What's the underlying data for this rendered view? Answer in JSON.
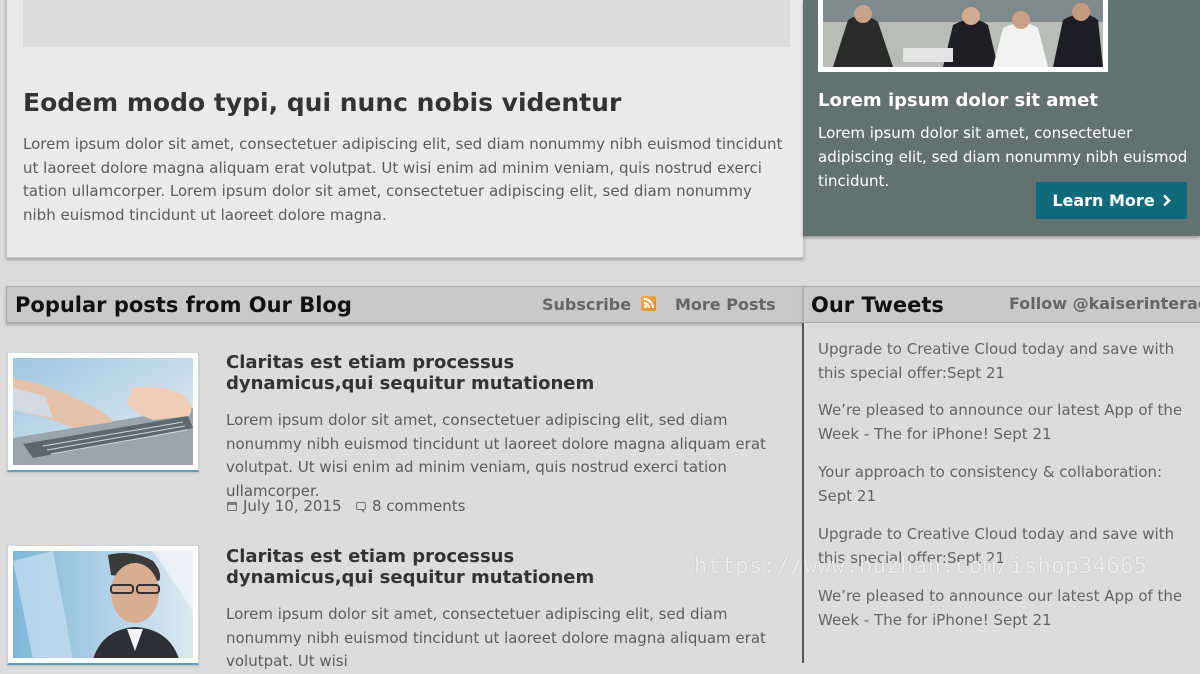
{
  "feature": {
    "title": "Eodem modo typi, qui nunc nobis videntur",
    "body": "Lorem ipsum dolor sit amet, consectetuer adipiscing elit, sed diam nonummy nibh euismod tincidunt ut laoreet dolore magna aliquam erat volutpat. Ut wisi enim ad minim veniam, quis nostrud exerci tation ullamcorper. Lorem ipsum dolor sit amet, consectetuer adipiscing elit, sed diam nonummy nibh euismod tincidunt ut laoreet dolore magna."
  },
  "promo": {
    "title": "Lorem ipsum dolor sit amet",
    "body": "Lorem ipsum dolor sit amet, consectetuer adipiscing elit, sed diam nonummy nibh euismod tincidunt.",
    "button_label": "Learn More",
    "button_icon": "chevron-right-icon",
    "panel_color": "#627270",
    "button_color": "#0f6b7c"
  },
  "blog": {
    "title": "Popular posts from Our Blog",
    "subscribe_label": "Subscribe",
    "rss_icon": "rss-icon",
    "more_label": "More Posts",
    "posts": [
      {
        "title": "Claritas est etiam processus dynamicus,qui sequitur mutationem",
        "excerpt": "Lorem ipsum dolor sit amet, consectetuer adipiscing elit, sed diam nonummy nibh euismod tincidunt ut laoreet dolore magna aliquam erat volutpat. Ut wisi enim ad minim veniam, quis nostrud exerci tation ullamcorper.",
        "date": "July 10, 2015",
        "comments": "8 comments",
        "image": "laptop-typing-photo"
      },
      {
        "title": "Claritas est etiam processus dynamicus,qui sequitur mutationem",
        "excerpt": "Lorem ipsum dolor sit amet, consectetuer adipiscing elit, sed diam nonummy nibh euismod tincidunt ut laoreet dolore magna aliquam erat volutpat. Ut wisi",
        "image": "businessman-photo"
      }
    ]
  },
  "tweets": {
    "title": "Our Tweets",
    "follow_label": "Follow @kaiserinteract",
    "items": [
      "Upgrade to Creative Cloud today and save with this special offer:Sept 21",
      "We’re pleased to announce our latest App of the Week - The for iPhone! Sept 21",
      "Your approach to consistency & collaboration: Sept 21",
      "Upgrade to Creative Cloud today and save with this special offer:Sept 21",
      "We’re pleased to announce our latest App of the Week - The for iPhone! Sept 21"
    ]
  },
  "watermark": "https://www.huzhan.com/ishop34665"
}
